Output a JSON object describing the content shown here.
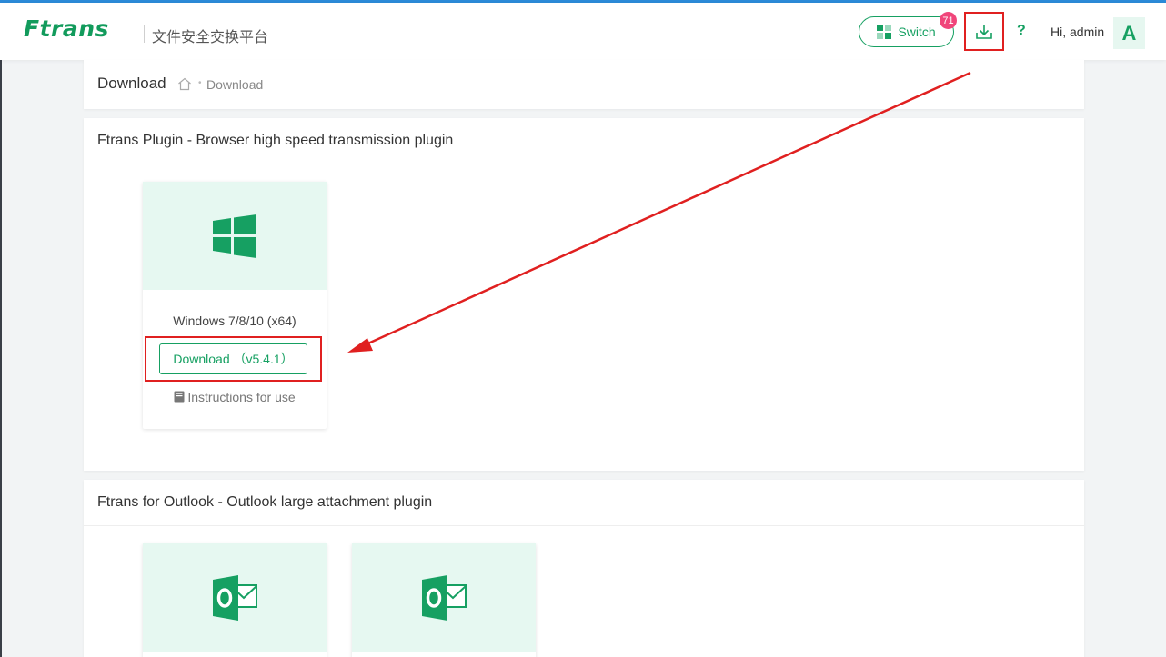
{
  "app": {
    "logo_text": "Ftrans",
    "subtitle": "文件安全交换平台"
  },
  "header": {
    "switch_label": "Switch",
    "download_badge": "71",
    "help_label": "?",
    "greeting": "Hi,  admin",
    "avatar_letter": "A"
  },
  "breadcrumb": {
    "title": "Download",
    "current": "Download"
  },
  "plugin_section": {
    "title": "Ftrans Plugin - Browser high speed transmission plugin",
    "cards": [
      {
        "os": "Windows 7/8/10 (x64)",
        "download_label": "Download （v5.4.1）",
        "instructions_label": "Instructions for use",
        "icon": "windows-icon"
      }
    ]
  },
  "outlook_section": {
    "title": "Ftrans for Outlook - Outlook large attachment plugin",
    "cards": [
      {
        "icon": "outlook-icon"
      },
      {
        "icon": "outlook-icon"
      }
    ]
  },
  "colors": {
    "brand_green": "#16a062",
    "annotation_red": "#e02020",
    "badge_pink": "#f0457a"
  }
}
